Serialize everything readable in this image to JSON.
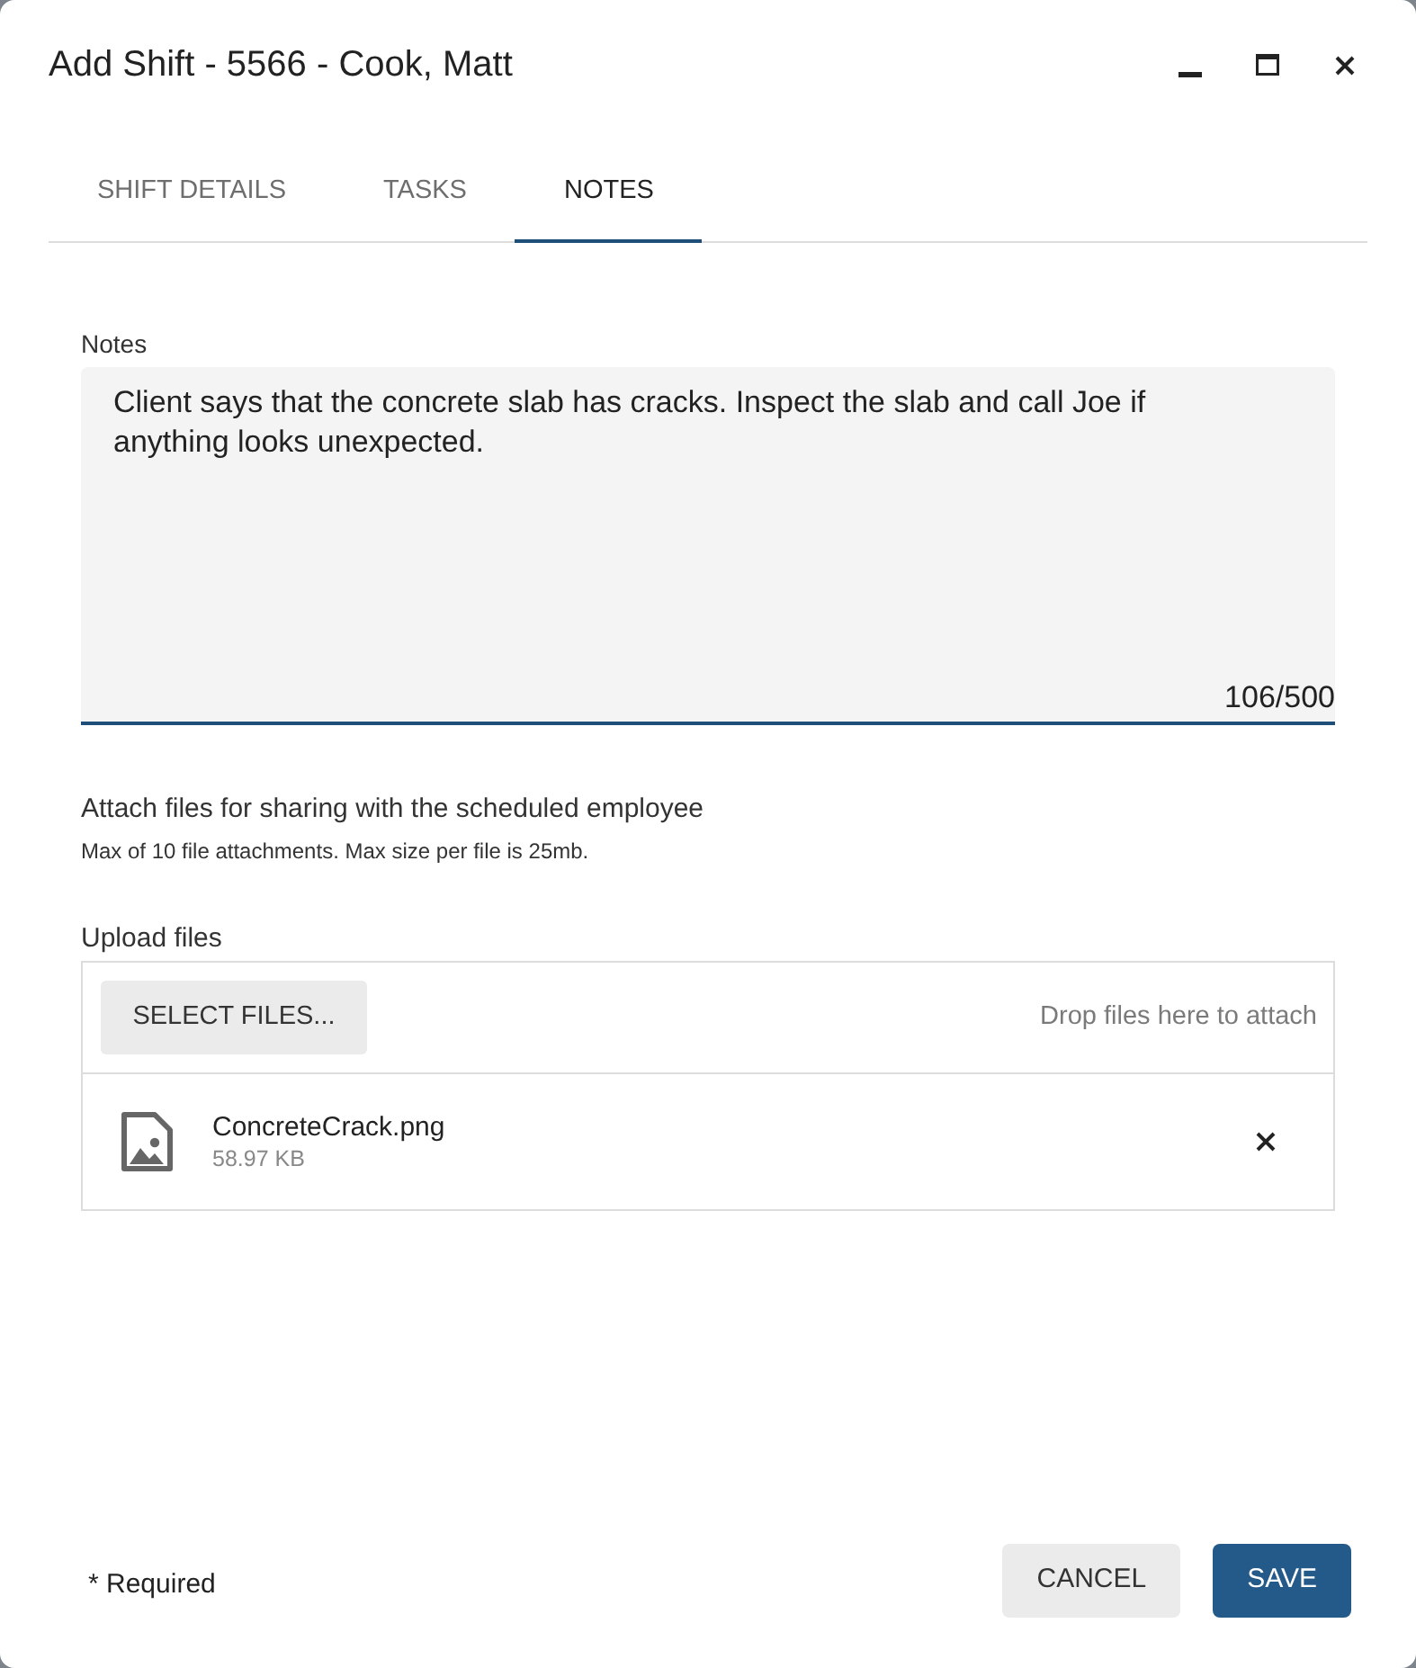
{
  "window": {
    "title": "Add Shift - 5566 - Cook, Matt"
  },
  "tabs": [
    {
      "label": "SHIFT DETAILS",
      "selected": false
    },
    {
      "label": "TASKS",
      "selected": false
    },
    {
      "label": "NOTES",
      "selected": true
    }
  ],
  "notes": {
    "label": "Notes",
    "value": "Client says that the concrete slab has cracks. Inspect the slab and call Joe if anything looks unexpected.",
    "counter": "106/500"
  },
  "attachments": {
    "heading": "Attach files for sharing with the scheduled employee",
    "hint": "Max of 10 file attachments. Max size per file is 25mb.",
    "upload_label": "Upload files",
    "select_button": "SELECT FILES...",
    "drop_hint": "Drop files here to attach",
    "files": [
      {
        "name": "ConcreteCrack.png",
        "size": "58.97 KB"
      }
    ]
  },
  "footer": {
    "required_note": "* Required",
    "buttons": [
      {
        "label": "CANCEL",
        "kind": "secondary"
      },
      {
        "label": "SAVE",
        "kind": "primary"
      }
    ]
  }
}
